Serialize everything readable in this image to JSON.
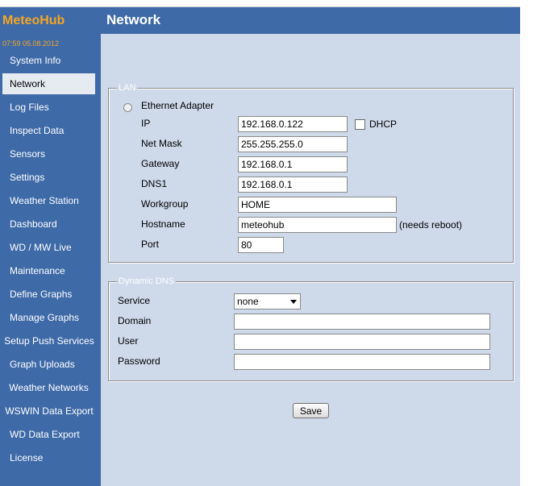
{
  "sidebar": {
    "brand": "MeteoHub",
    "clock": "07:59  05.08.2012",
    "items": [
      {
        "label": "System Info"
      },
      {
        "label": "Network"
      },
      {
        "label": "Log Files"
      },
      {
        "label": "Inspect Data"
      },
      {
        "label": "Sensors"
      },
      {
        "label": "Settings"
      },
      {
        "label": "Weather Station"
      },
      {
        "label": "Dashboard"
      },
      {
        "label": "WD / MW Live"
      },
      {
        "label": "Maintenance"
      },
      {
        "label": "Define Graphs"
      },
      {
        "label": "Manage Graphs"
      },
      {
        "label": "Setup Push Services"
      },
      {
        "label": "Graph Uploads"
      },
      {
        "label": "Weather Networks"
      },
      {
        "label": "WSWIN Data Export"
      },
      {
        "label": "WD Data Export"
      },
      {
        "label": "License"
      }
    ],
    "active_index": 1
  },
  "header": {
    "title": "Network"
  },
  "lan": {
    "legend": "LAN",
    "adapter_label": "Ethernet Adapter",
    "ip_label": "IP",
    "ip_value": "192.168.0.122",
    "dhcp_label": "DHCP",
    "netmask_label": "Net Mask",
    "netmask_value": "255.255.255.0",
    "gateway_label": "Gateway",
    "gateway_value": "192.168.0.1",
    "dns1_label": "DNS1",
    "dns1_value": "192.168.0.1",
    "workgroup_label": "Workgroup",
    "workgroup_value": "HOME",
    "hostname_label": "Hostname",
    "hostname_value": "meteohub",
    "hostname_note": "(needs reboot)",
    "port_label": "Port",
    "port_value": "80"
  },
  "ddns": {
    "legend": "Dynamic DNS",
    "service_label": "Service",
    "service_value": "none",
    "domain_label": "Domain",
    "domain_value": "",
    "user_label": "User",
    "user_value": "",
    "password_label": "Password",
    "password_value": ""
  },
  "actions": {
    "save_label": "Save"
  }
}
